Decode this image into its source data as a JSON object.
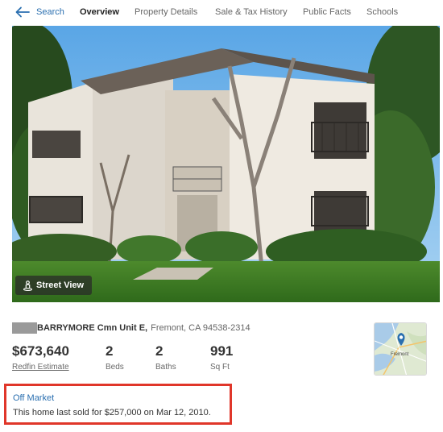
{
  "nav": {
    "back_label": "Search",
    "tabs": [
      {
        "label": "Overview",
        "active": true
      },
      {
        "label": "Property Details",
        "active": false
      },
      {
        "label": "Sale & Tax History",
        "active": false
      },
      {
        "label": "Public Facts",
        "active": false
      },
      {
        "label": "Schools",
        "active": false
      }
    ]
  },
  "photo": {
    "street_view_label": "Street View"
  },
  "listing": {
    "address_street": "BARRYMORE Cmn Unit E,",
    "address_city": "Fremont, CA 94538-2314",
    "price": "$673,640",
    "price_label": "Redfin Estimate",
    "beds": "2",
    "beds_label": "Beds",
    "baths": "2",
    "baths_label": "Baths",
    "sqft": "991",
    "sqft_label": "Sq Ft"
  },
  "map": {
    "place_label": "Fremont"
  },
  "status": {
    "title": "Off Market",
    "text": "This home last sold for $257,000 on Mar 12, 2010."
  },
  "colors": {
    "link": "#2a6fb0",
    "highlight_border": "#e0362a"
  },
  "icons": [
    "back-arrow-icon",
    "street-view-person-icon",
    "map-pin-icon"
  ]
}
